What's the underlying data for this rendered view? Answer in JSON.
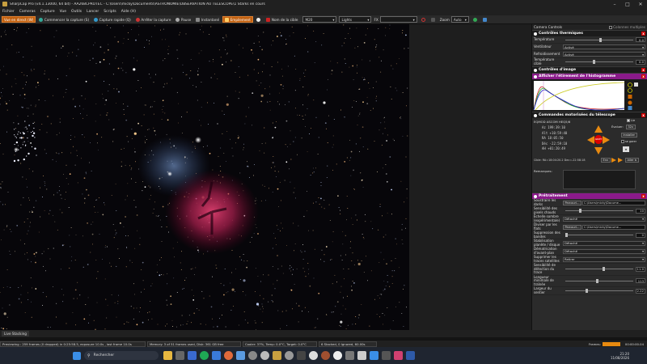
{
  "window": {
    "title": "SharpCap Pro (v4.1.13000, 64 bit) - AA268CPROTEC - C:\\Users\\micky\\Documents\\ASTRONOMIE\\OBSERVATION AU TELESCOPE\\1 Starks en cours"
  },
  "menu": [
    "Fichier",
    "Cameras",
    "Capture",
    "Vue",
    "Outils",
    "Lancer",
    "Scripts",
    "Aide (H)"
  ],
  "toolbar": {
    "live": "Vue en direct (W)",
    "start": "Commencer la capture (S)",
    "quick": "Capture rapide (Q)",
    "stop": "Arrêter la capture",
    "pause": "Pause",
    "snapshot": "Instantané",
    "stacking": "Empilement",
    "target_label": "Nom de la cible",
    "target_value": "M20",
    "profile_value": "Lights",
    "fx_label": "FX",
    "zoom_label": "Zoom",
    "zoom_value": "Auto"
  },
  "panel": {
    "header": "Camera Controls",
    "header_check": "Colonnes multiples",
    "thermal": {
      "title": "Contrôles thermiques",
      "temp_label": "Température",
      "temp_value": "0.0",
      "fan_label": "Ventilateur",
      "fan_value": "Activé",
      "cooling_label": "Refroidissement",
      "cooling_value": "Activé",
      "target_label": "Température cible",
      "target_value": "0.0"
    },
    "image": {
      "title": "Contrôles d'image"
    },
    "histogram": {
      "title": "Afficher l'étirement de l'histogramme"
    },
    "telescope": {
      "title": "Commandes motorisées du télescope",
      "mount": "EQMOD ASCOM HEQ5/6",
      "track_check": "Lie",
      "az": "Az   199:39:10",
      "alt": "Alt  +10:59:40",
      "ra": "RA    18:05:50",
      "dec": "Déc  -22:59:10",
      "ah": "AH   +01:20:49",
      "eval_label": "Évaluer:",
      "eval_value": "32x",
      "install": "Installer",
      "park": "se garer",
      "stop": "ARRÊT",
      "goto_text": "Cible: RA=18:04:20.2 Dec=-22:58:18",
      "goto_btn": "Env",
      "goto_to": "Aller à",
      "notes_label": "Remarques:"
    },
    "preprocessing": {
      "title": "Prétraitement",
      "dark_label": "Soustraire les darks",
      "dark_browse": "Parcouri...",
      "dark_path": "C:\\Users\\micky\\Docume...",
      "hotpix_label": "Sensibilité des pixels chauds",
      "hotpix_value": "10",
      "darkscale_label": "Échelle sombre (expérimentale)",
      "darkscale_value": "Détaché",
      "flat_label": "Diviser par les flats",
      "flat_browse": "Parcouri...",
      "flat_path": "C:\\Users\\micky\\Docume...",
      "banding_label": "Suppression des bandes",
      "banding_value": "0",
      "stab_label": "Stabilisation planète / disque",
      "stab_value": "Détaché",
      "debayer_label": "Dématrication d'avant-plan",
      "debayer_value": "Détaché",
      "sat_label": "Supprimer les traces satellites",
      "sat_value": "Retirer",
      "detsens_label": "Sensibilité de détection du trace",
      "detsens_value": "11.0",
      "minlen_label": "Longueur minimale de traînée",
      "minlen_value": "113",
      "width_label": "Largeur du sentier",
      "width_value": "2.22"
    }
  },
  "status": {
    "live_stacking": "Live Stacking",
    "previewing": "Previewing : 259 frames (0 dropped) in 0:25:58.5, exposure 10.0s , last frame 10.0s",
    "memory": "Memory: 3 of 51 frames used, Disk: 361 GB free",
    "cooler": "Cooler: 37%, Temp: 0.0°C, Target: 0.0°C",
    "stacked": "6 Stacked, 0 Ignored, 60.00s",
    "frames_label": "Frames:",
    "elapsed": "00:00:00.04"
  },
  "taskbar": {
    "search": "Rechercher",
    "time": "21:20",
    "date": "11/08/2026"
  },
  "colors": {
    "accent": "#c06010",
    "section_magenta": "#8a1a8a",
    "nebula_red": "#c02050",
    "nebula_blue": "#4a6a9a"
  }
}
